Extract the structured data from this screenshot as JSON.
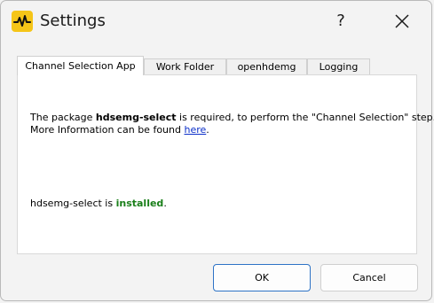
{
  "window": {
    "title": "Settings",
    "help_label": "?",
    "close_icon": "close-icon",
    "app_icon": "pulse-icon",
    "accent_color": "#f5c518"
  },
  "tabs": [
    {
      "label": "Channel Selection App",
      "active": true
    },
    {
      "label": "Work Folder",
      "active": false
    },
    {
      "label": "openhdemg",
      "active": false
    },
    {
      "label": "Logging",
      "active": false
    }
  ],
  "panel": {
    "line1_prefix": "The package ",
    "package_name": "hdsemg-select",
    "line1_suffix": " is required, to perform the \"Channel Selection\" step.",
    "line2_prefix": "More Information can be found ",
    "link_text": "here",
    "line2_suffix": ".",
    "status_prefix": "hdsemg-select is ",
    "status_value": "installed",
    "status_suffix": ".",
    "status_color": "#1a7f1a",
    "link_color": "#0b2fc9"
  },
  "buttons": {
    "ok": "OK",
    "cancel": "Cancel"
  }
}
